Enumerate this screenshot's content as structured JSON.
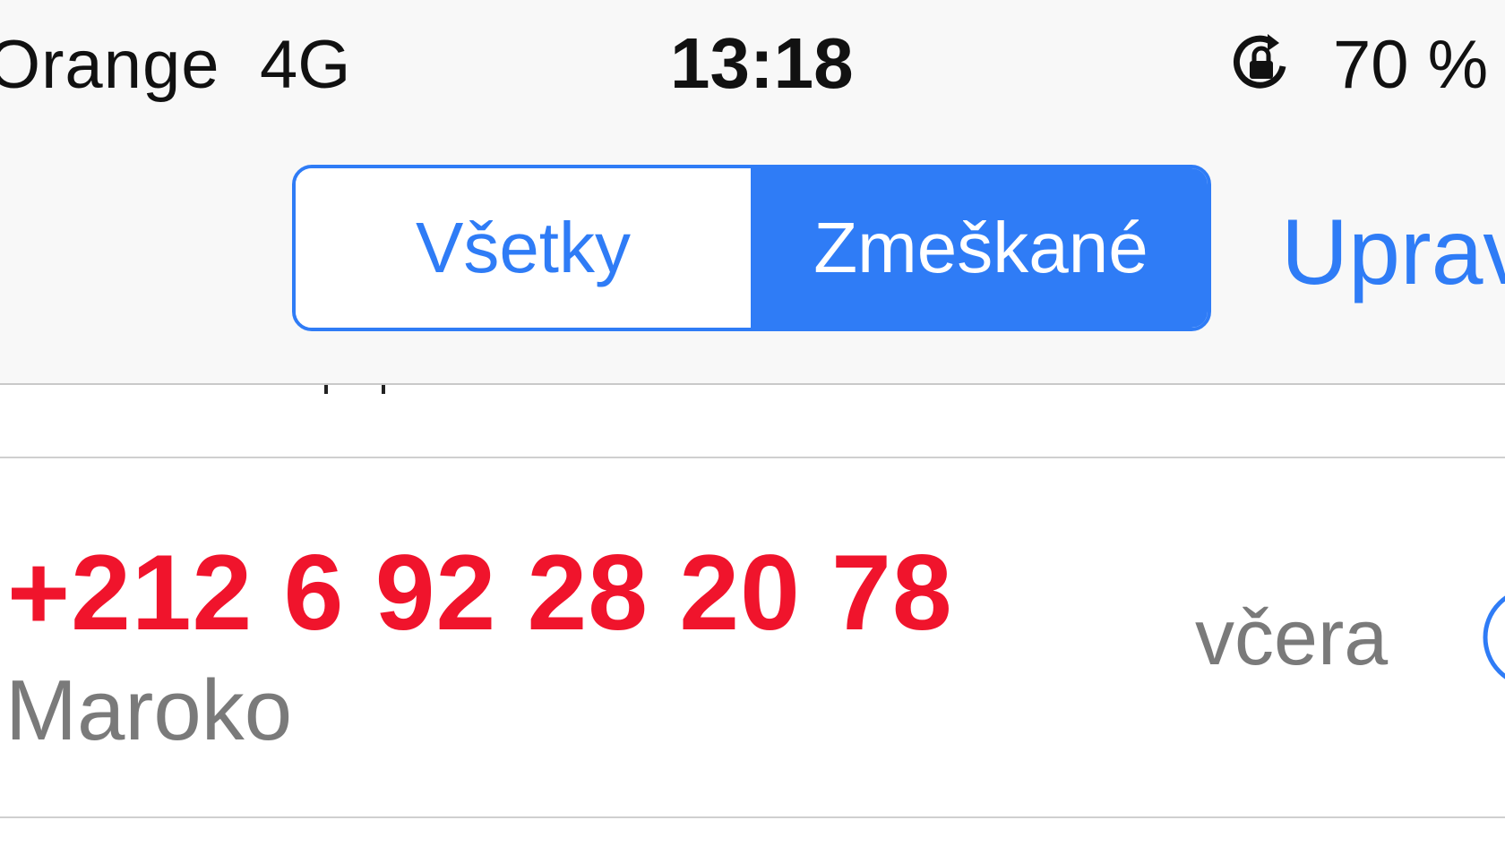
{
  "status_bar": {
    "carrier": "Orange",
    "network": "4G",
    "time": "13:18",
    "battery": "70 %",
    "rotation_icon": "rotation-lock-icon"
  },
  "nav": {
    "segments": [
      "Všetky",
      "Zmeškané"
    ],
    "selected_segment": "Zmeškané",
    "edit_label": "Upraviť"
  },
  "calls": [
    {
      "number": "+212 6 92 28 20 78",
      "location": "Maroko",
      "time": "včera",
      "icon": "info-icon"
    }
  ],
  "colors": {
    "accent": "#2f7cf6",
    "missed": "#f0142c",
    "secondary_text": "#7a7a7a"
  }
}
